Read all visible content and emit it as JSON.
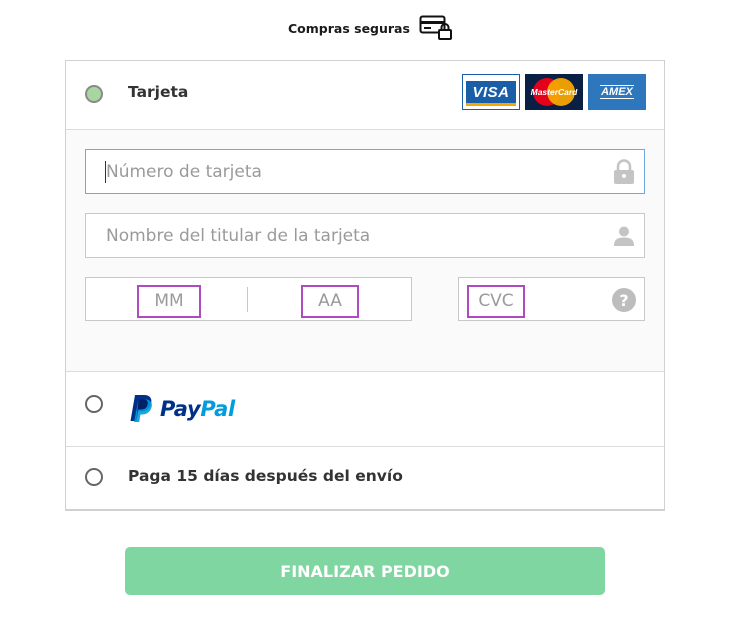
{
  "header": {
    "secure_label": "Compras seguras",
    "secure_icon": "credit-card-lock-icon"
  },
  "payment_options": {
    "card": {
      "label": "Tarjeta",
      "selected": true,
      "brands": [
        "VISA",
        "MasterCard",
        "AMEX"
      ],
      "number_placeholder": "Número de tarjeta",
      "number_icon": "lock-icon",
      "holder_placeholder": "Nombre del titular de la tarjeta",
      "holder_icon": "user-icon",
      "month_placeholder": "MM",
      "year_placeholder": "AA",
      "cvc_placeholder": "CVC",
      "cvc_help_glyph": "?"
    },
    "paypal": {
      "word_pay": "Pay",
      "word_pal": "Pal",
      "selected": false
    },
    "pay_later": {
      "label": "Paga 15 días después del envío",
      "selected": false
    }
  },
  "submit_label": "FINALIZAR PEDIDO",
  "colors": {
    "submit_bg": "#7fd6a0",
    "radio_selected": "#a8d5a0",
    "focus_border": "#6fa9dd",
    "highlight": "#b04ac0",
    "paypal_dark": "#003087",
    "paypal_light": "#009cde"
  }
}
